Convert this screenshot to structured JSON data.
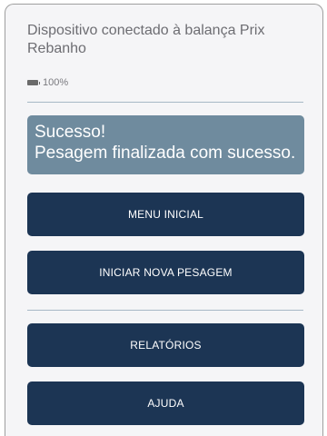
{
  "status": {
    "device_text": "Dispositivo conectado à balança Prix Rebanho",
    "battery_icon": "battery-icon",
    "battery_level": "100%"
  },
  "alert": {
    "title": "Sucesso!",
    "message": "Pesagem finalizada com sucesso.",
    "color": "#6f8b9e"
  },
  "buttons": {
    "menu_inicial": "MENU INICIAL",
    "nova_pesagem": "INICIAR NOVA PESAGEM",
    "relatorios": "RELATÓRIOS",
    "ajuda": "AJUDA"
  },
  "colors": {
    "button": "#1c3554",
    "background": "#f5f5f7",
    "divider": "#a7b8c6"
  }
}
